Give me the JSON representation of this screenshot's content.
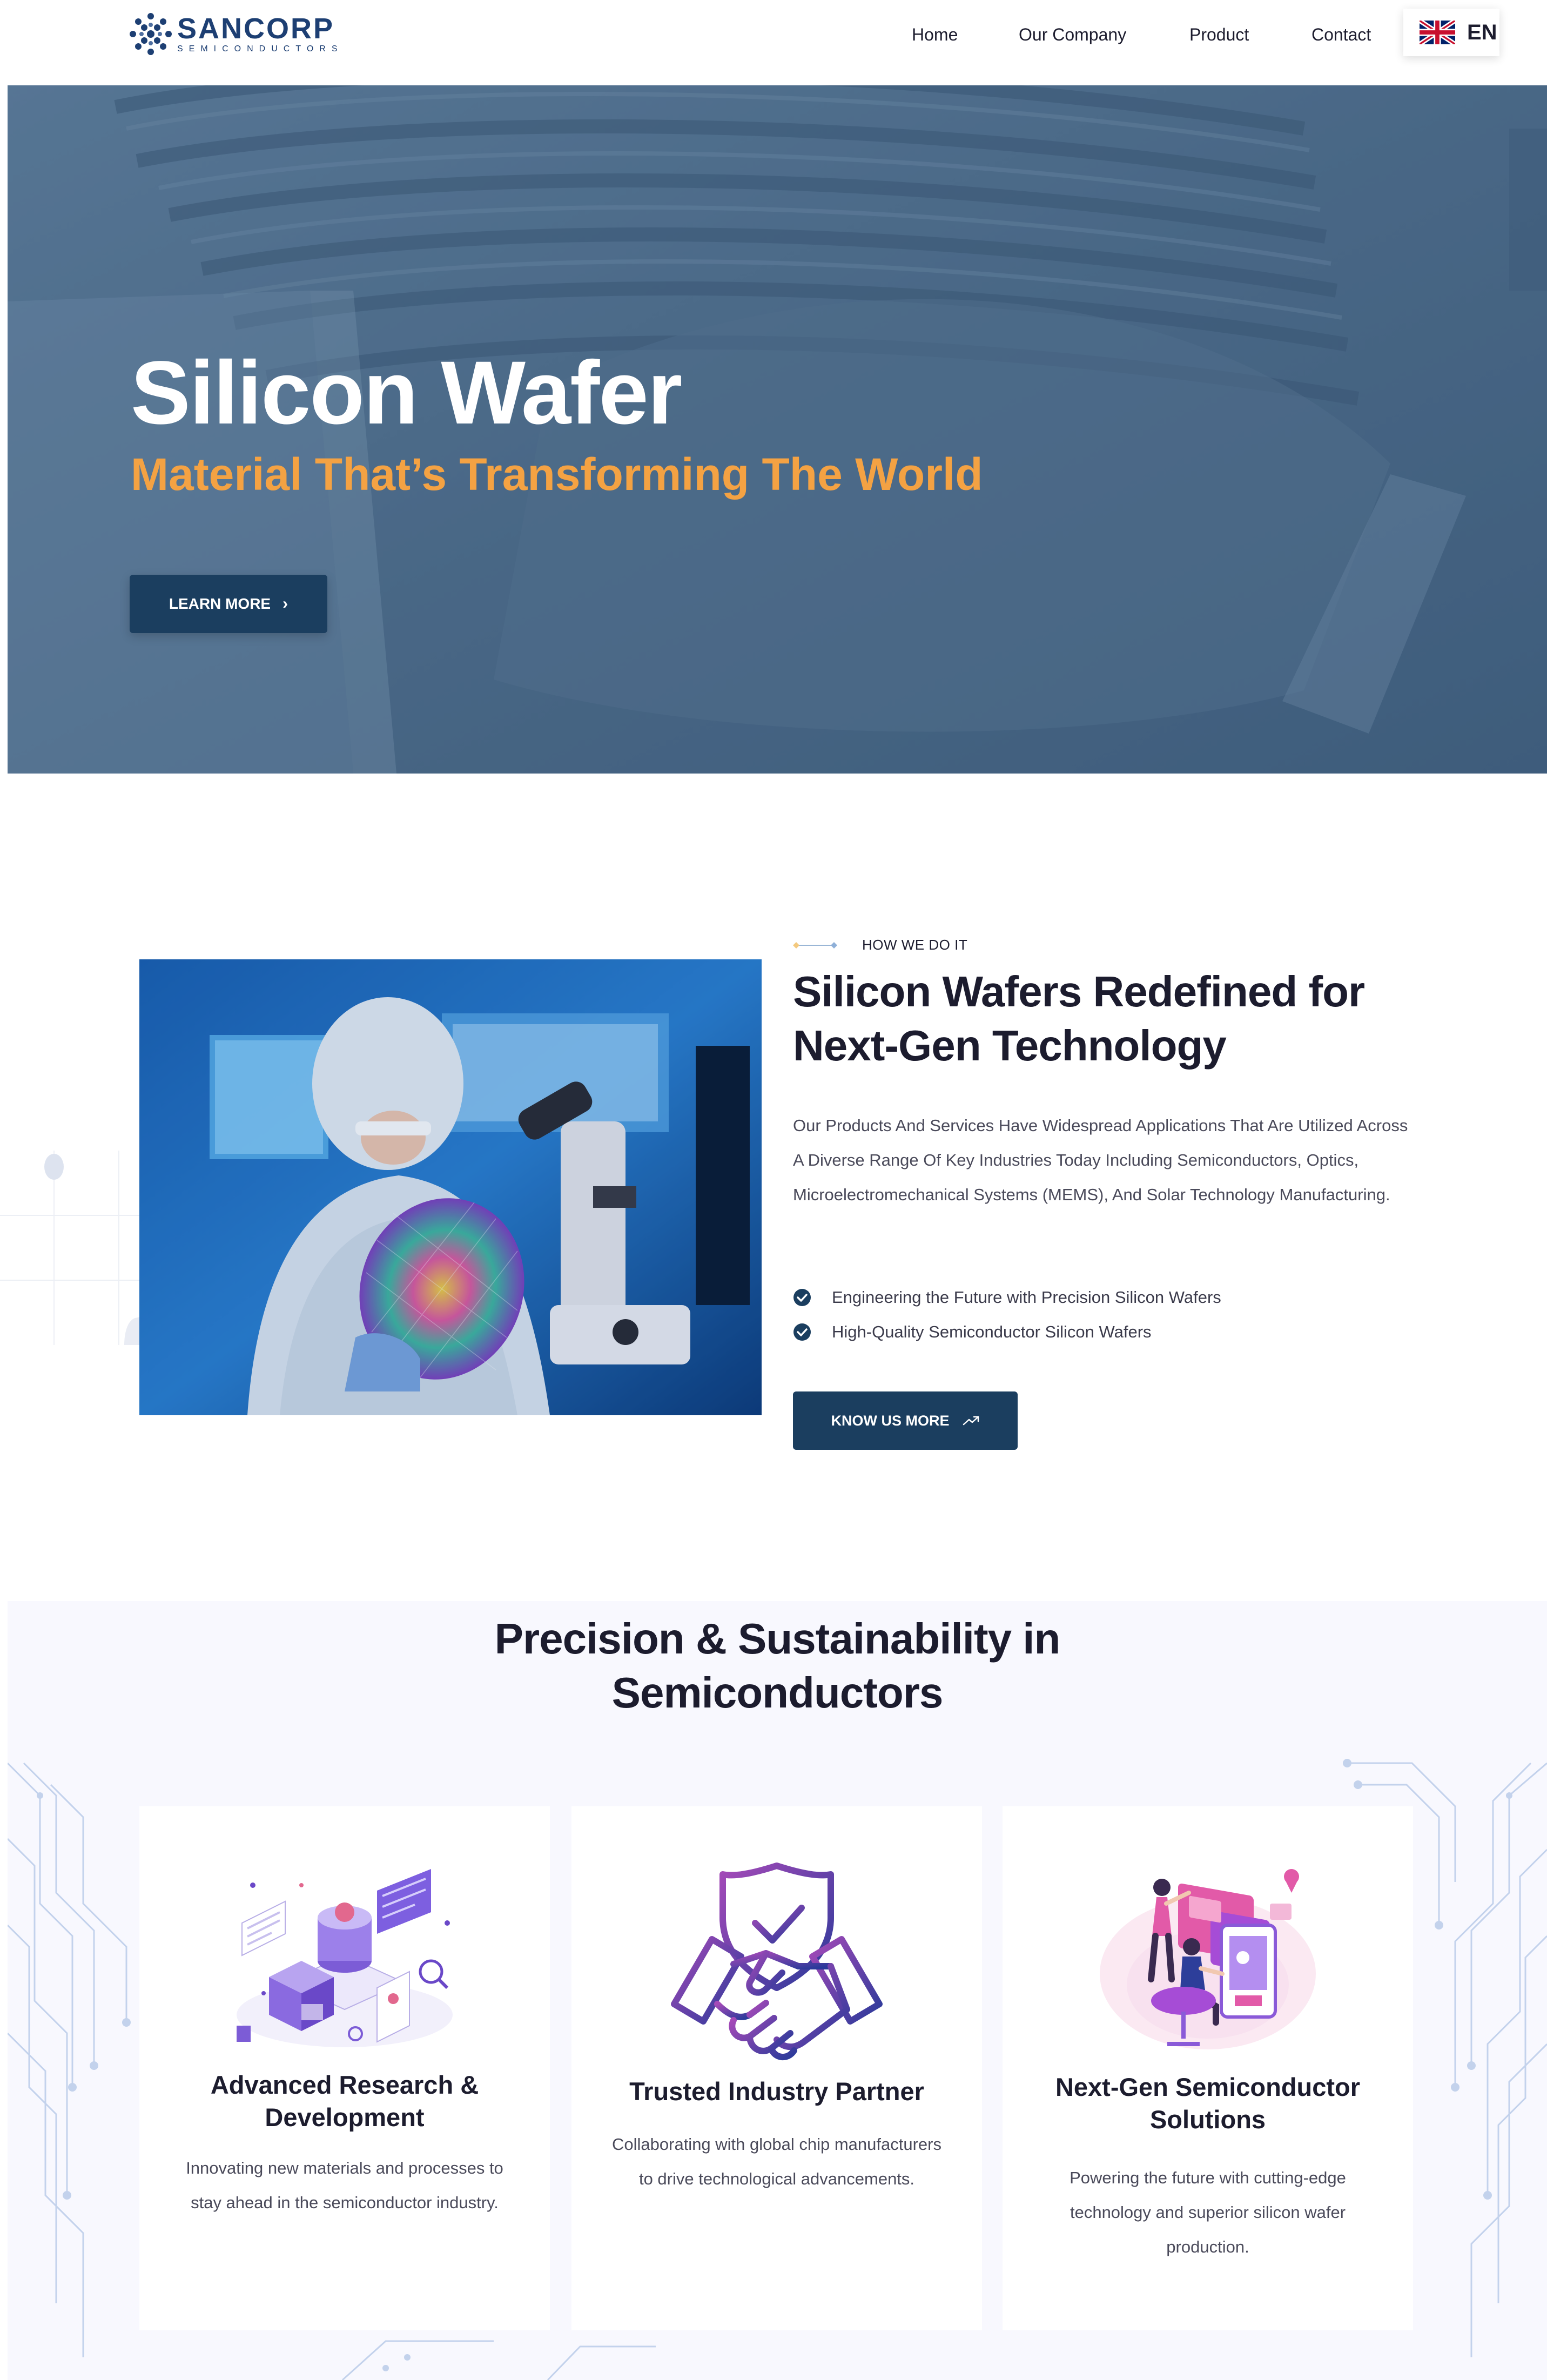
{
  "header": {
    "logo": {
      "name": "SANCORP",
      "tagline": "SEMICONDUCTORS"
    },
    "nav": [
      {
        "label": "Home"
      },
      {
        "label": "Our Company"
      },
      {
        "label": "Product"
      },
      {
        "label": "Contact"
      }
    ],
    "language": {
      "code": "EN",
      "flag_icon": "uk-flag-icon"
    }
  },
  "hero": {
    "title": "Silicon Wafer",
    "subtitle": "Material That’s Transforming The World",
    "button_label": "LEARN MORE",
    "button_icon": "chevron-right-icon"
  },
  "about": {
    "tag": "HOW WE DO IT",
    "title_line1": "Silicon Wafers Redefined for",
    "title_line2": "Next-Gen Technology",
    "body": "Our Products And Services Have Widespread Applications That Are Utilized Across A Diverse Range Of Key Industries Today Including Semiconductors, Optics, Microelectromechanical Systems (MEMS), And Solar Technology Manufacturing.",
    "checklist": [
      {
        "text": "Engineering the Future with Precision Silicon Wafers"
      },
      {
        "text": "High-Quality Semiconductor Silicon Wafers"
      }
    ],
    "button_label": "KNOW US MORE",
    "button_icon": "trending-up-icon"
  },
  "features": {
    "title_line1": "Precision & Sustainability in",
    "title_line2": "Semiconductors",
    "cards": [
      {
        "title_line1": "Advanced Research &",
        "title_line2": "Development",
        "description": "Innovating new materials and processes to stay ahead in the semiconductor industry.",
        "icon": "research-lab-icon"
      },
      {
        "title_line1": "Trusted Industry Partner",
        "title_line2": "",
        "description": "Collaborating with global chip manufacturers to drive technological advancements.",
        "icon": "handshake-shield-icon"
      },
      {
        "title_line1": "Next-Gen Semiconductor",
        "title_line2": "Solutions",
        "description": "Powering the future with cutting-edge technology and superior silicon wafer production.",
        "icon": "tech-team-icon"
      }
    ]
  },
  "colors": {
    "brand_navy": "#1b3e5f",
    "accent_orange": "#f4a243",
    "hero_blue": "#4c6a88",
    "section_bg": "#f8f8fe",
    "check_icon": "#1b3e5f"
  }
}
